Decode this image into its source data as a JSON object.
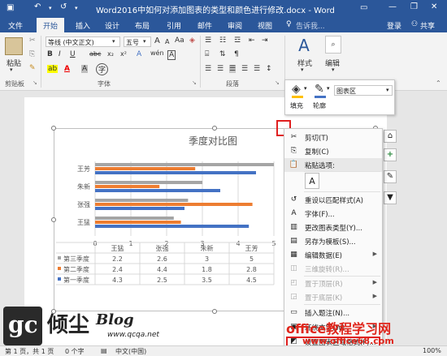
{
  "window": {
    "title": "Word2016中如何对添加图表的类型和颜色进行修改.docx - Word",
    "minimize": "—",
    "restore": "❐",
    "close": "✕",
    "quick_save_icon": "save-icon",
    "undo_icon": "undo-icon",
    "redo_icon": "redo-icon"
  },
  "tabs": {
    "file": "文件",
    "home": "开始",
    "insert": "插入",
    "design": "设计",
    "layout": "布局",
    "references": "引用",
    "mailings": "邮件",
    "review": "审阅",
    "view": "视图",
    "tell_me": "告诉我...",
    "login": "登录",
    "share": "共享"
  },
  "ribbon": {
    "paste_label": "粘贴",
    "clipboard_group": "剪贴板",
    "font_name": "等线 (中文正文)",
    "font_size": "五号",
    "font_group": "字体",
    "paragraph_group": "段落",
    "styles_label": "样式",
    "styles_group": "样式",
    "edit_label": "编辑",
    "bold": "B",
    "italic": "I",
    "underline": "U",
    "strike": "abc",
    "sub": "x₂",
    "sup": "x²",
    "font_color": "A",
    "highlight": "ab",
    "grow": "A",
    "shrink": "A",
    "char_border": "A",
    "aa": "Aa",
    "wen": "wén",
    "enclose": "字"
  },
  "minitoolbar": {
    "fill_label": "填充",
    "outline_label": "轮廓",
    "select_value": "图表区"
  },
  "chart_data": {
    "type": "bar",
    "title": "季度对比图",
    "categories": [
      "王芳",
      "朱新",
      "张强",
      "王猛"
    ],
    "series": [
      {
        "name": "第三季度",
        "color": "#a5a5a5",
        "values": [
          5,
          3,
          2.6,
          2.2
        ]
      },
      {
        "name": "第二季度",
        "color": "#ed7d31",
        "values": [
          2.8,
          1.8,
          4.4,
          2.4
        ]
      },
      {
        "name": "第一季度",
        "color": "#4472c4",
        "values": [
          4.5,
          3.5,
          2.5,
          4.3
        ]
      }
    ],
    "xlim": [
      0,
      5
    ],
    "xticks": [
      "0",
      "1",
      "2",
      "3",
      "4",
      "5"
    ],
    "table": {
      "headers": [
        "王猛",
        "张强",
        "朱新",
        "王芳"
      ],
      "rows": [
        {
          "name": "第三季度",
          "values": [
            "2.2",
            "2.6",
            "3",
            "5"
          ]
        },
        {
          "name": "第二季度",
          "values": [
            "2.4",
            "4.4",
            "1.8",
            "2.8"
          ]
        },
        {
          "name": "第一季度",
          "values": [
            "4.3",
            "2.5",
            "3.5",
            "4.5"
          ]
        }
      ]
    }
  },
  "context_menu": {
    "items": [
      {
        "label": "剪切(T)",
        "icon": "✂",
        "icon_name": "cut-icon",
        "disabled": false,
        "arrow": false
      },
      {
        "label": "复制(C)",
        "icon": "⎘",
        "icon_name": "copy-icon",
        "disabled": false,
        "arrow": false
      },
      {
        "label": "粘贴选项:",
        "icon": "📋",
        "icon_name": "paste-icon",
        "disabled": false,
        "arrow": false
      },
      {
        "label": "",
        "icon": "",
        "icon_name": "",
        "disabled": false,
        "arrow": false
      },
      {
        "label": "重设以匹配样式(A)",
        "icon": "↺",
        "icon_name": "reset-style-icon",
        "disabled": false,
        "arrow": false
      },
      {
        "label": "字体(F)...",
        "icon": "A",
        "icon_name": "font-icon",
        "disabled": false,
        "arrow": false
      },
      {
        "label": "更改图表类型(Y)...",
        "icon": "▥",
        "icon_name": "change-chart-type-icon",
        "disabled": false,
        "arrow": false
      },
      {
        "label": "另存为模板(S)...",
        "icon": "▤",
        "icon_name": "save-template-icon",
        "disabled": false,
        "arrow": false
      },
      {
        "label": "编辑数据(E)",
        "icon": "▦",
        "icon_name": "edit-data-icon",
        "disabled": false,
        "arrow": true
      },
      {
        "label": "三维旋转(R)...",
        "icon": "◫",
        "icon_name": "3d-rotation-icon",
        "disabled": true,
        "arrow": false
      },
      {
        "label": "置于顶层(R)",
        "icon": "◰",
        "icon_name": "bring-front-icon",
        "disabled": true,
        "arrow": true
      },
      {
        "label": "置于底层(K)",
        "icon": "◲",
        "icon_name": "send-back-icon",
        "disabled": true,
        "arrow": true
      },
      {
        "label": "插入题注(N)...",
        "icon": "▭",
        "icon_name": "insert-caption-icon",
        "disabled": false,
        "arrow": false
      },
      {
        "label": "环绕文字(W)",
        "icon": "▣",
        "icon_name": "wrap-text-icon",
        "disabled": false,
        "arrow": true
      },
      {
        "label": "设置图表区域格式(F)...",
        "icon": "◩",
        "icon_name": "format-chart-area-icon",
        "disabled": false,
        "arrow": false
      }
    ]
  },
  "status": {
    "page": "第 1 页，共 1 页",
    "words": "0 个字",
    "lang": "中文(中国)",
    "zoom": "100%"
  },
  "watermark": {
    "logo_text": "gc",
    "brand": "倾尘",
    "blog": "Blog",
    "url": "www.qcqa.net",
    "site_cn": "office教程学习网",
    "site_url": "www.office68.com"
  }
}
